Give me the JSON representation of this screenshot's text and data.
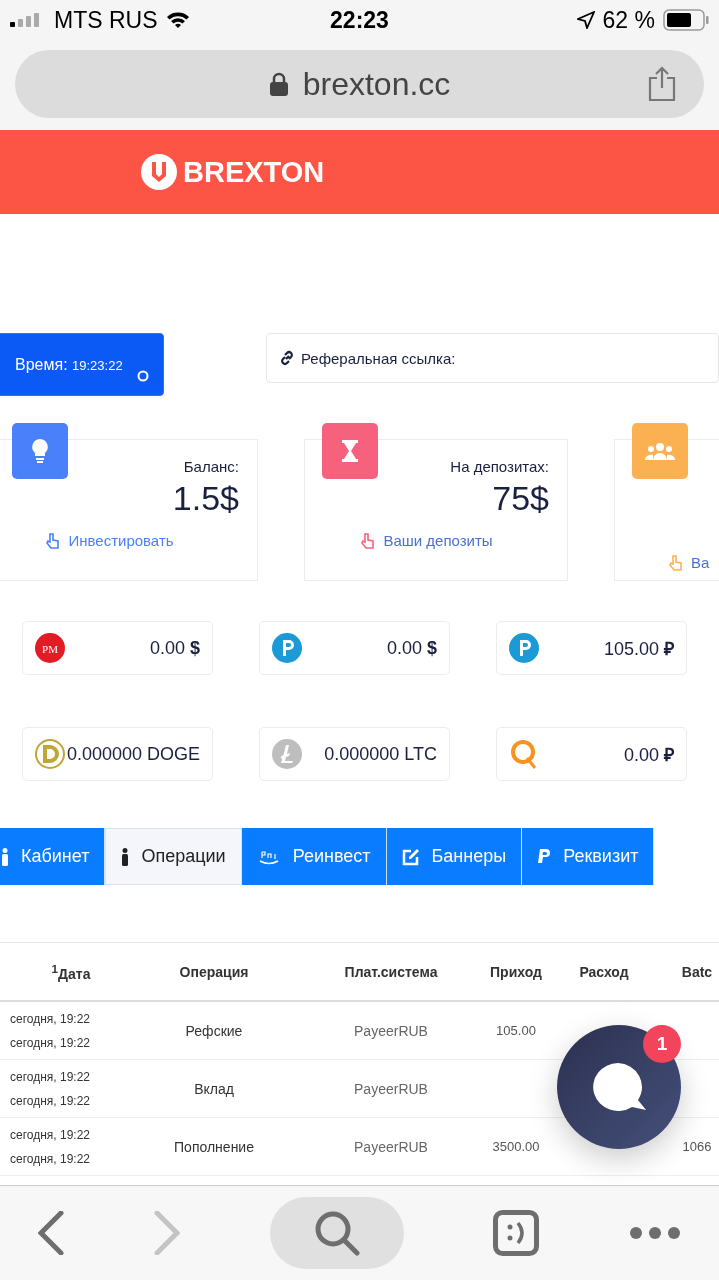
{
  "status_bar": {
    "carrier": "MTS RUS",
    "time": "22:23",
    "battery": "62 %"
  },
  "browser": {
    "url": "brexton.cc"
  },
  "header": {
    "logo": "BREXTON"
  },
  "time_box": {
    "label": "Время:",
    "value": "19:23:22"
  },
  "referral": {
    "label": "Реферальная ссылка:"
  },
  "stats": [
    {
      "kind": "bulb",
      "color": "#4a80fa",
      "label": "Баланс:",
      "value": "1.5$",
      "link": "Инвестировать"
    },
    {
      "kind": "hourglass",
      "color": "#f6627e",
      "label": "На депозитах:",
      "value": "75$",
      "link": "Ваши депозиты"
    },
    {
      "kind": "users",
      "color": "#fbb152",
      "link": "Ва"
    }
  ],
  "wallets": [
    {
      "kind": "pm",
      "icon_text": "PM",
      "amount": "0.00 **$**"
    },
    {
      "kind": "payeer",
      "amount": "0.00 **$**"
    },
    {
      "kind": "payeer",
      "amount": "105.00 **₽**"
    },
    {
      "kind": "doge",
      "amount": "0.000000 DOGE"
    },
    {
      "kind": "ltc",
      "amount": "0.000000 LTC"
    },
    {
      "kind": "qiwi",
      "amount": "0.00 **₽**"
    }
  ],
  "tabs": [
    {
      "kind": "person",
      "label": "Кабинет",
      "selected": false
    },
    {
      "kind": "person",
      "label": "Операции",
      "selected": true
    },
    {
      "kind": "pay",
      "label": "Реинвест",
      "selected": false
    },
    {
      "kind": "edit",
      "label": "Баннеры",
      "selected": false
    },
    {
      "kind": "paypal",
      "label": "Реквизит",
      "selected": false
    }
  ],
  "table": {
    "columns": [
      "$^{1}$Дата",
      "Операция",
      "Плат.система",
      "Приход",
      "Расход",
      "Batc"
    ],
    "rows": [
      {
        "dates": [
          "сегодня, 19:22",
          "сегодня, 19:22"
        ],
        "operation": "Рефские",
        "system": "PayeerRUB",
        "income": "105.00"
      },
      {
        "dates": [
          "сегодня, 19:22",
          "сегодня, 19:22"
        ],
        "operation": "Вклад",
        "system": "PayeerRUB"
      },
      {
        "dates": [
          "сегодня, 19:22",
          "сегодня, 19:22"
        ],
        "operation": "Пополнение",
        "system": "PayeerRUB",
        "income": "3500.00",
        "batch": "1066"
      }
    ]
  },
  "chat": {
    "badge": "1"
  }
}
